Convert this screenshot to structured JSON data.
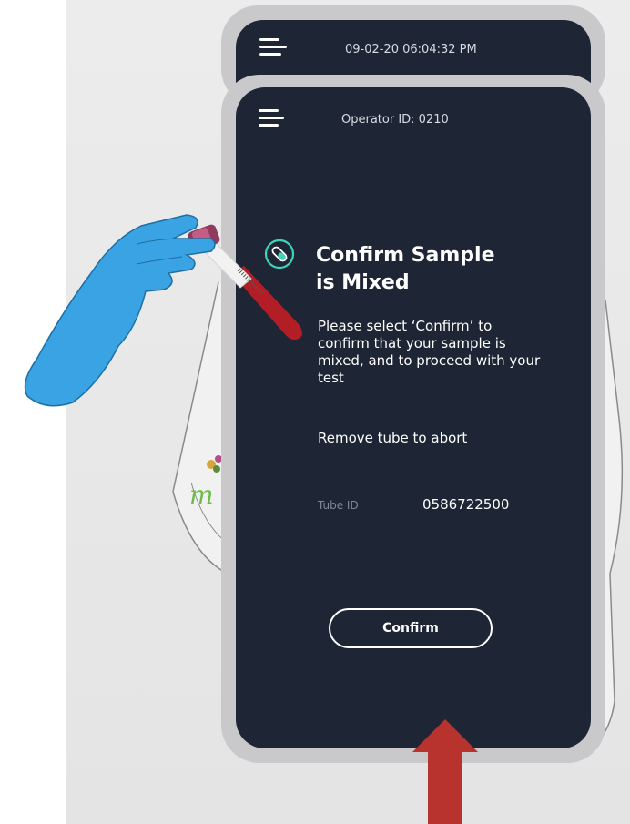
{
  "header": {
    "datetime": "09-02-20 06:04:32 PM",
    "operator": "Operator ID: 0210"
  },
  "screen": {
    "title_line1": "Confirm Sample",
    "title_line2": "is Mixed",
    "body": "Please select ‘Confirm’ to confirm that your sample is mixed, and to proceed with your test",
    "abort": "Remove tube to abort",
    "tube_id_label": "Tube ID",
    "tube_id_value": "0586722500",
    "confirm_button": "Confirm"
  },
  "icons": {
    "menu": "hamburger-menu-icon",
    "status": "test-tube-icon",
    "arrow": "up-arrow-icon"
  },
  "colors": {
    "screen_bg": "#1e2535",
    "device_frame": "#c9c9cc",
    "accent_teal": "#3fd4b8",
    "glove_blue": "#3aa3e3",
    "arrow_red": "#b8332d"
  },
  "logo_text": "m"
}
